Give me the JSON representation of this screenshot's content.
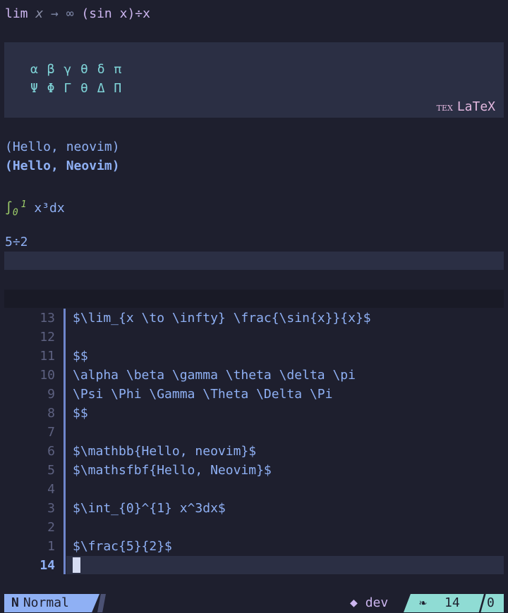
{
  "render": {
    "limit": {
      "lim": "lim",
      "x": "x",
      "arrow": "→",
      "inf": "∞",
      "expr": "(sin x)÷x"
    },
    "greek_lower": "α β γ θ δ π",
    "greek_upper": "Ψ Φ Γ θ Δ Π",
    "latex_badge": {
      "tex": "TEX",
      "label": "LaTeX"
    },
    "mathbb": "(Hello, neovim)",
    "mathsfbf": "(Hello, Neovim)",
    "integral": {
      "sign": "∫",
      "lower": "0",
      "upper": "1",
      "body": "x³dx"
    },
    "fraction": "5÷2"
  },
  "editor": {
    "lines": [
      {
        "num": "13",
        "text": "$\\lim_{x \\to \\infty} \\frac{\\sin{x}}{x}$"
      },
      {
        "num": "12",
        "text": ""
      },
      {
        "num": "11",
        "text": "$$"
      },
      {
        "num": "10",
        "text": "\\alpha \\beta \\gamma \\theta \\delta \\pi"
      },
      {
        "num": "9",
        "text": "\\Psi \\Phi \\Gamma \\Theta \\Delta \\Pi"
      },
      {
        "num": "8",
        "text": "$$"
      },
      {
        "num": "7",
        "text": ""
      },
      {
        "num": "6",
        "text": "$\\mathbb{Hello, neovim}$"
      },
      {
        "num": "5",
        "text": "$\\mathsfbf{Hello, Neovim}$"
      },
      {
        "num": "4",
        "text": ""
      },
      {
        "num": "3",
        "text": "$\\int_{0}^{1} x^3dx$"
      },
      {
        "num": "2",
        "text": ""
      },
      {
        "num": "1",
        "text": "$\\frac{5}{2}$"
      },
      {
        "num": "14",
        "text": ""
      }
    ]
  },
  "statusline": {
    "mode_icon": "N",
    "mode": "Normal",
    "branch_icon": "◆",
    "branch": "dev",
    "pos_icon": "❧",
    "line": "14",
    "col": "0"
  },
  "colors": {
    "accent": "#8fb0f4",
    "background": "#1e1f2e",
    "teal": "#8fdcd4",
    "lavender": "#cdb6f0"
  }
}
